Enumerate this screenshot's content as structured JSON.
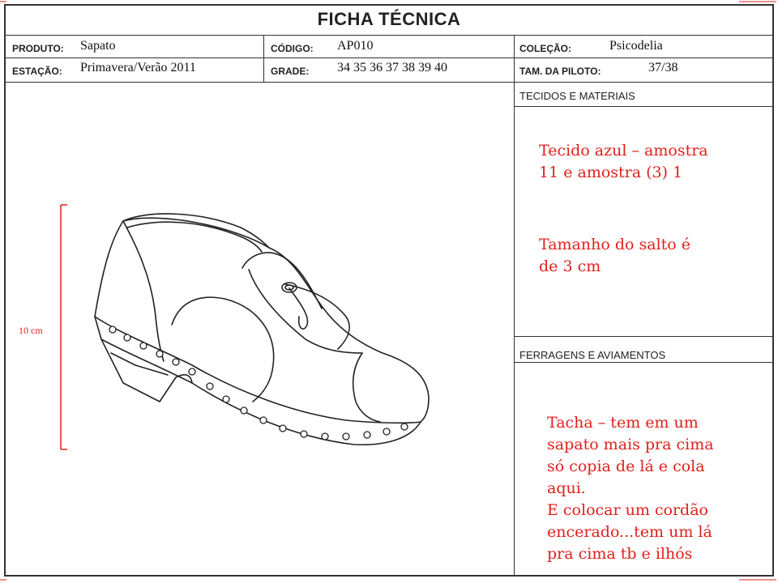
{
  "header": {
    "title": "FICHA TÉCNICA"
  },
  "fields": {
    "produto": {
      "label": "PRODUTO:",
      "value": "Sapato"
    },
    "codigo": {
      "label": "CÓDIGO:",
      "value": "AP010"
    },
    "colecao": {
      "label": "COLEÇÃO:",
      "value": "Psicodelia"
    },
    "estacao": {
      "label": "ESTAÇÃO:",
      "value": "Primavera/Verão 2011"
    },
    "grade": {
      "label": "GRADE:",
      "value": "34 35 36 37 38 39 40"
    },
    "tam_piloto": {
      "label": "TAM. DA PILOTO:",
      "value": "37/38"
    }
  },
  "sections": {
    "tecidos": {
      "heading": "TECIDOS E MATERIAIS",
      "note1": "Tecido azul – amostra\n11 e amostra (3) 1",
      "note2": "Tamanho do salto é\nde 3 cm"
    },
    "ferragens": {
      "heading": "FERRAGENS E AVIAMENTOS",
      "note": "Tacha – tem em um\nsapato mais pra cima\nsó copia de lá e cola\naqui.\nE colocar um cordão\nencerado...tem um lá\npra cima tb e ilhós"
    }
  },
  "drawing": {
    "dimension_label": "10 cm",
    "subject": "shoe-technical-drawing",
    "annotation_color": "#e0201c"
  }
}
